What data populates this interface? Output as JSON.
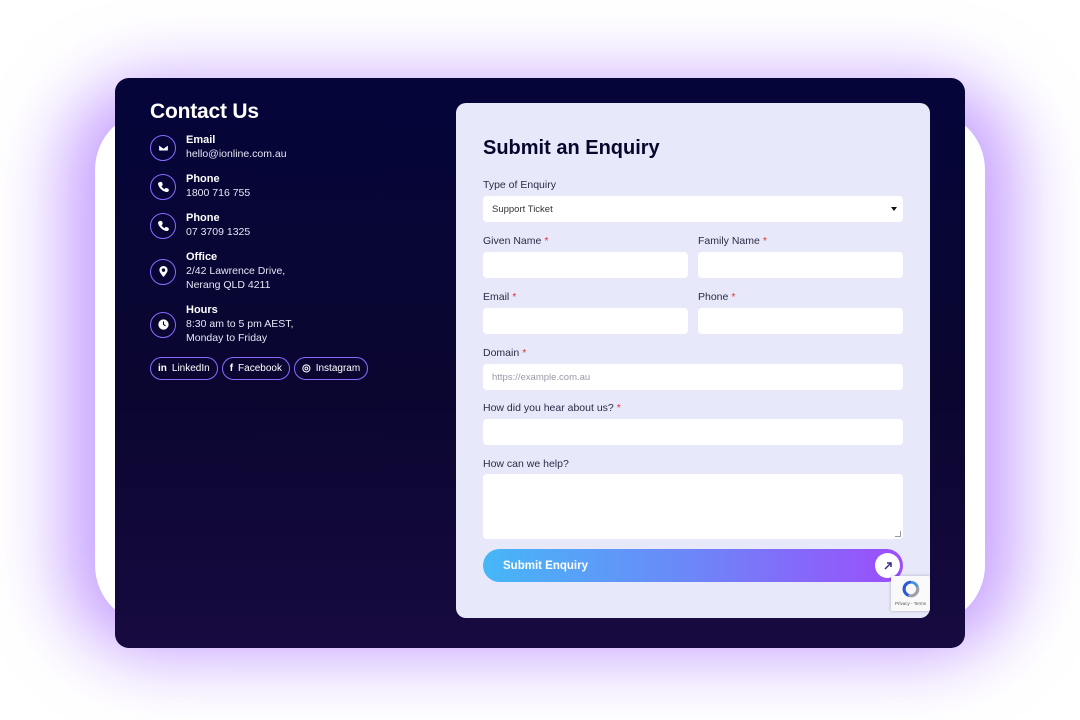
{
  "contact": {
    "title": "Contact Us",
    "items": [
      {
        "label": "Email",
        "lines": [
          "hello@ionline.com.au"
        ],
        "icon": "envelope-icon"
      },
      {
        "label": "Phone",
        "lines": [
          "1800 716 755"
        ],
        "icon": "phone-icon"
      },
      {
        "label": "Phone",
        "lines": [
          "07 3709 1325"
        ],
        "icon": "phone-icon"
      },
      {
        "label": "Office",
        "lines": [
          "2/42 Lawrence Drive,",
          "Nerang QLD 4211"
        ],
        "icon": "map-pin-icon"
      },
      {
        "label": "Hours",
        "lines": [
          "8:30 am to 5 pm AEST,",
          "Monday to Friday"
        ],
        "icon": "clock-icon"
      }
    ],
    "social": [
      {
        "label": "LinkedIn",
        "icon_text": "in",
        "icon": "linkedin-icon"
      },
      {
        "label": "Facebook",
        "icon_text": "f",
        "icon": "facebook-icon"
      },
      {
        "label": "Instagram",
        "icon_text": "◎",
        "icon": "instagram-icon"
      }
    ]
  },
  "form": {
    "title": "Submit an Enquiry",
    "enquiry_type_label": "Type of Enquiry",
    "enquiry_type_value": "Support Ticket",
    "given_name_label": "Given Name",
    "family_name_label": "Family Name",
    "email_label": "Email",
    "phone_label": "Phone",
    "domain_label": "Domain",
    "domain_placeholder": "https://example.com.au",
    "hear_label": "How did you hear about us?",
    "help_label": "How can we help?",
    "required_mark": "*",
    "submit_label": "Submit Enquiry",
    "recaptcha_text": "Privacy - Terms"
  },
  "colors": {
    "card_bg": "#05053a",
    "panel_bg": "#e7e9fa",
    "accent": "#8a6bff",
    "required": "#e53030",
    "button_start": "#46b7f7",
    "button_end": "#9c4dfb"
  }
}
